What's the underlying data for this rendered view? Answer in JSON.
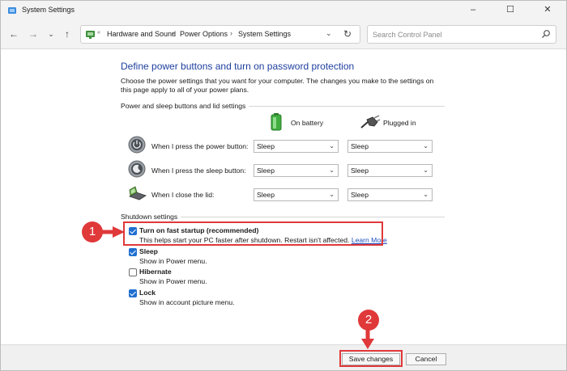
{
  "window": {
    "title": "System Settings",
    "minimize_glyph": "–",
    "maximize_glyph": "☐",
    "close_glyph": "✕"
  },
  "nav": {
    "back_glyph": "←",
    "forward_glyph": "→",
    "history_glyph": "⌄",
    "up_glyph": "↑",
    "address_chevron": "«",
    "breadcrumbs": [
      "Hardware and Sound",
      "Power Options",
      "System Settings"
    ],
    "breadcrumb_sep": "›",
    "dropdown_glyph": "⌄",
    "refresh_glyph": "↻"
  },
  "search": {
    "placeholder": "Search Control Panel"
  },
  "main": {
    "heading": "Define power buttons and turn on password protection",
    "description": "Choose the power settings that you want for your computer. The changes you make to the settings on this page apply to all of your power plans.",
    "power_section_title": "Power and sleep buttons and lid settings",
    "col_battery": "On battery",
    "col_plugged": "Plugged in",
    "rows": [
      {
        "label": "When I press the power button:",
        "battery": "Sleep",
        "plugged": "Sleep",
        "icon": "power-button-icon"
      },
      {
        "label": "When I press the sleep button:",
        "battery": "Sleep",
        "plugged": "Sleep",
        "icon": "sleep-button-icon"
      },
      {
        "label": "When I close the lid:",
        "battery": "Sleep",
        "plugged": "Sleep",
        "icon": "laptop-lid-icon"
      }
    ],
    "shutdown_title": "Shutdown settings",
    "shutdown_options": [
      {
        "label": "Turn on fast startup (recommended)",
        "description": "This helps start your PC faster after shutdown. Restart isn't affected.",
        "link": "Learn More",
        "checked": true
      },
      {
        "label": "Sleep",
        "description": "Show in Power menu.",
        "checked": true
      },
      {
        "label": "Hibernate",
        "description": "Show in Power menu.",
        "checked": false
      },
      {
        "label": "Lock",
        "description": "Show in account picture menu.",
        "checked": true
      }
    ]
  },
  "annotations": {
    "badge_1": "1",
    "badge_2": "2",
    "highlight_color": "#e0393a"
  },
  "footer": {
    "save_label": "Save changes",
    "cancel_label": "Cancel"
  },
  "colors": {
    "heading": "#1e3f9e",
    "link": "#1e4fbf",
    "checkbox": "#1f6fd0"
  }
}
